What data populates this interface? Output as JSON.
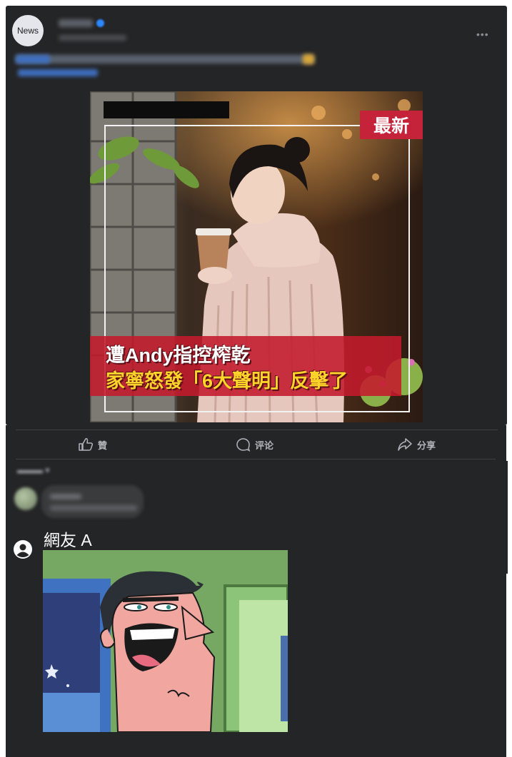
{
  "post": {
    "page_avatar_text": "News",
    "page_name": "",
    "timestamp": "",
    "body_text": "",
    "more_icon": "more-horizontal-icon",
    "image": {
      "badge_text": "最新",
      "caption_line1": "遭Andy指控榨乾",
      "caption_line2": "家寧怒發「6大聲明」反擊了"
    }
  },
  "actions": {
    "like_label": "贊",
    "comment_label": "评论",
    "share_label": "分享"
  },
  "reply": {
    "name": "網友 A",
    "icon": "user-icon"
  },
  "colors": {
    "panel": "#242526",
    "text_muted": "#b0b3b8",
    "badge_red": "#c4233a",
    "caption_yellow": "#ffd42a"
  }
}
